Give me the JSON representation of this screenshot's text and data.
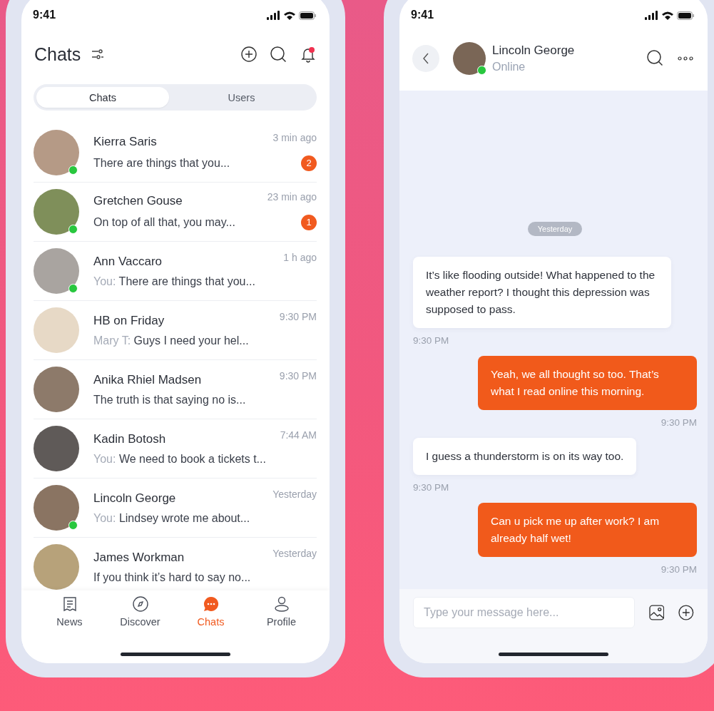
{
  "chat_list_screen": {
    "status_bar": {
      "time": "9:41"
    },
    "header": {
      "title": "Chats",
      "notification_dot": true
    },
    "tabs": [
      {
        "label": "Chats",
        "selected": true
      },
      {
        "label": "Users",
        "selected": false
      }
    ],
    "chats": [
      {
        "name": "Kierra Saris",
        "time": "3 min ago",
        "preview": "There are things that you...",
        "unread": "2",
        "online": true
      },
      {
        "name": "Gretchen Gouse",
        "time": "23 min ago",
        "preview": "On top of all that, you may...",
        "unread": "1",
        "online": true
      },
      {
        "name": "Ann Vaccaro",
        "time": "1 h ago",
        "sender": "You:",
        "preview": "There are things that you...",
        "online": true
      },
      {
        "name": "HB on Friday",
        "time": "9:30 PM",
        "sender": "Mary T:",
        "preview": "Guys I need your hel...",
        "online": false
      },
      {
        "name": "Anika Rhiel Madsen",
        "time": "9:30 PM",
        "preview": "The truth is that saying no is...",
        "online": false
      },
      {
        "name": "Kadin Botosh",
        "time": "7:44 AM",
        "sender": "You:",
        "preview": "We need to book a tickets t...",
        "online": false
      },
      {
        "name": "Lincoln George",
        "time": "Yesterday",
        "sender": "You:",
        "preview": "Lindsey wrote me about...",
        "online": true
      },
      {
        "name": "James Workman",
        "time": "Yesterday",
        "preview": "If you think it’s hard to say no...",
        "online": false
      }
    ],
    "bottom_nav": [
      {
        "label": "News",
        "selected": false
      },
      {
        "label": "Discover",
        "selected": false
      },
      {
        "label": "Chats",
        "selected": true
      },
      {
        "label": "Profile",
        "selected": false
      }
    ]
  },
  "conversation_screen": {
    "status_bar": {
      "time": "9:41"
    },
    "contact": {
      "name": "Lincoln George",
      "status": "Online",
      "online": true
    },
    "date_divider": "Yesterday",
    "messages": [
      {
        "kind": "incoming",
        "text": "It’s like flooding outside! What happened to the weather report? I thought this depression was supposed to pass.",
        "time": "9:30 PM"
      },
      {
        "kind": "outgoing",
        "text": "Yeah, we all thought so too. That’s what I read online this morning.",
        "time": "9:30 PM"
      },
      {
        "kind": "incoming",
        "text": "I guess a thunderstorm is on its way too.",
        "time": "9:30 PM"
      },
      {
        "kind": "outgoing",
        "text": "Can u pick me up after work? I am already half wet!",
        "time": "9:30 PM"
      }
    ],
    "composer": {
      "placeholder": "Type your message here..."
    }
  }
}
